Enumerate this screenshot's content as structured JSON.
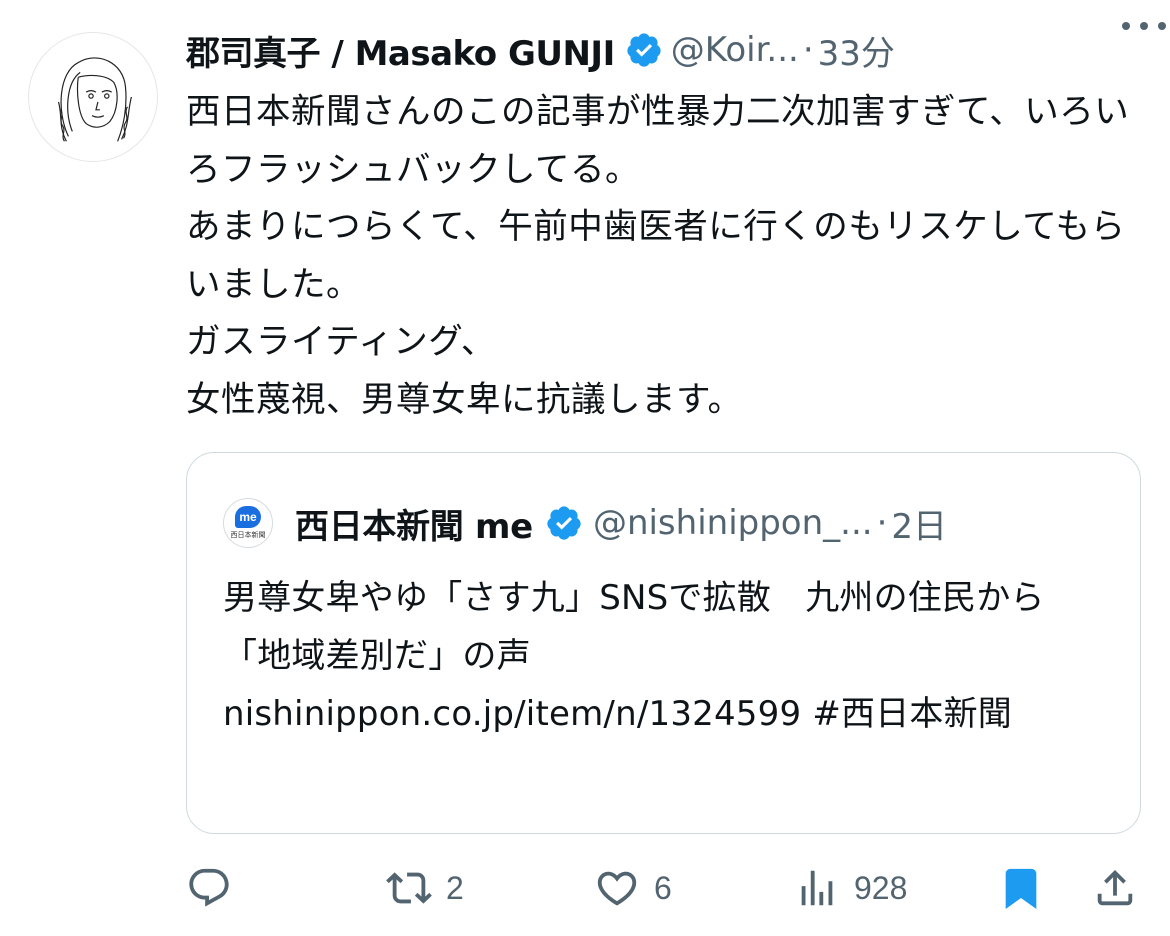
{
  "author": {
    "display_name": "郡司真子 / Masako GUNJI",
    "handle": "@Koir...",
    "time": "33分",
    "avatar_icon": "illustrated-portrait-avatar"
  },
  "separator": "·",
  "tweet": {
    "text": "西日本新聞さんのこの記事が性暴力二次加害すぎて、いろいろフラッシュバックしてる。\nあまりにつらくて、午前中歯医者に行くのもリスケしてもらいました。\nガスライティング、\n女性蔑視、男尊女卑に抗議します。"
  },
  "quoted": {
    "display_name": "西日本新聞 me",
    "handle": "@nishinippon_...",
    "time": "2日",
    "avatar_badge": "me",
    "avatar_caption": "西日本新聞",
    "text": "男尊女卑やゆ「さす九」SNSで拡散　九州の住民から「地域差別だ」の声\nnishinippon.co.jp/item/n/1324599 #西日本新聞"
  },
  "actions": {
    "reply_icon": "reply-icon",
    "retweet_count": "2",
    "like_count": "6",
    "views_count": "928",
    "bookmark_state": "bookmarked",
    "share_icon": "share-icon"
  },
  "colors": {
    "verified": "#1d9bf0",
    "bookmark": "#1d9bf0",
    "secondary_text": "#536471",
    "border": "#cfd9de"
  }
}
